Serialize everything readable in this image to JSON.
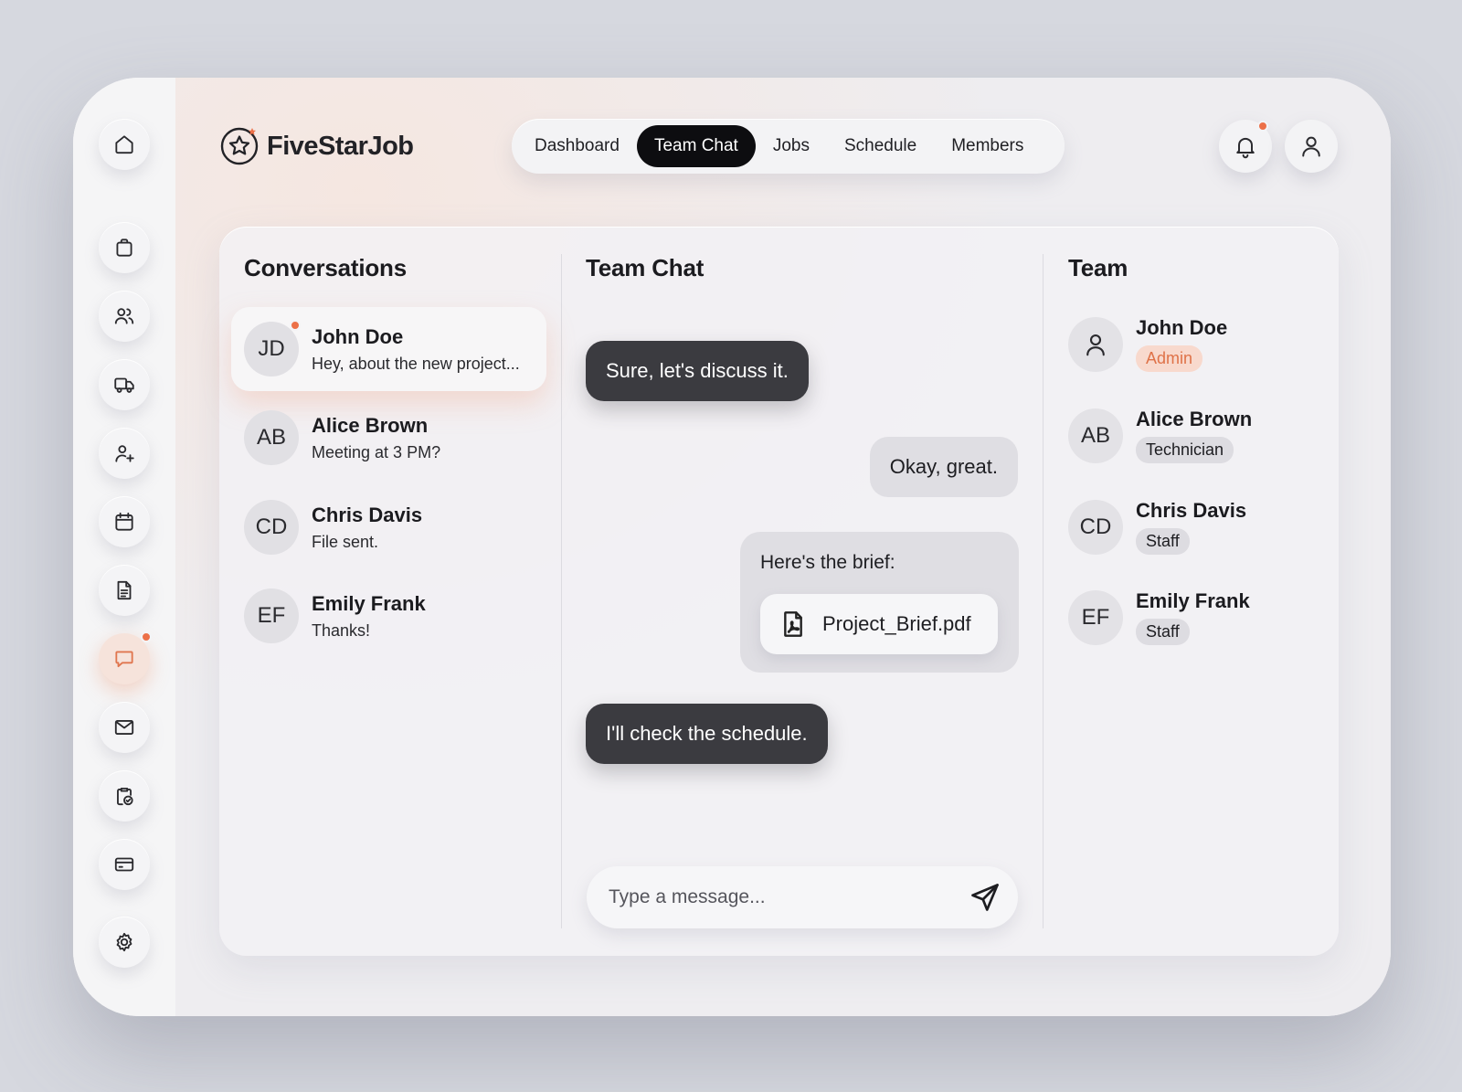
{
  "app": {
    "name": "FiveStarJob"
  },
  "nav": {
    "tabs": [
      {
        "label": "Dashboard"
      },
      {
        "label": "Team Chat",
        "active": true
      },
      {
        "label": "Jobs"
      },
      {
        "label": "Schedule"
      },
      {
        "label": "Members"
      }
    ]
  },
  "sidebar": {
    "items": [
      {
        "icon": "home-icon"
      },
      {
        "icon": "briefcase-icon"
      },
      {
        "icon": "users-icon"
      },
      {
        "icon": "truck-icon"
      },
      {
        "icon": "user-plus-icon"
      },
      {
        "icon": "calendar-icon"
      },
      {
        "icon": "document-icon"
      },
      {
        "icon": "chat-icon",
        "active": true,
        "notification": true
      },
      {
        "icon": "mail-icon"
      },
      {
        "icon": "clipboard-check-icon"
      },
      {
        "icon": "card-icon"
      },
      {
        "icon": "gear-icon"
      }
    ]
  },
  "conversations": {
    "title": "Conversations",
    "items": [
      {
        "initials": "JD",
        "name": "John Doe",
        "preview": "Hey, about the new project...",
        "active": true,
        "unread": true
      },
      {
        "initials": "AB",
        "name": "Alice Brown",
        "preview": "Meeting at 3 PM?"
      },
      {
        "initials": "CD",
        "name": "Chris Davis",
        "preview": "File sent."
      },
      {
        "initials": "EF",
        "name": "Emily Frank",
        "preview": "Thanks!"
      }
    ]
  },
  "chat": {
    "title": "Team Chat",
    "messages": [
      {
        "text": "Sure, let's discuss it.",
        "direction": "incoming"
      },
      {
        "text": "Okay, great.",
        "direction": "outgoing"
      },
      {
        "text": "Here's the brief:",
        "direction": "outgoing",
        "attachment": "Project_Brief.pdf"
      },
      {
        "text": "I'll check the schedule.",
        "direction": "incoming"
      }
    ],
    "input_placeholder": "Type a message..."
  },
  "team": {
    "title": "Team",
    "members": [
      {
        "initials": "",
        "name": "John Doe",
        "role": "Admin"
      },
      {
        "initials": "AB",
        "name": "Alice Brown",
        "role": "Technician"
      },
      {
        "initials": "CD",
        "name": "Chris Davis",
        "role": "Staff"
      },
      {
        "initials": "EF",
        "name": "Emily Frank",
        "role": "Staff"
      }
    ]
  },
  "colors": {
    "accent": "#ec7048",
    "dark_bubble": "#3b3b40",
    "active_tab": "#0d0d10"
  }
}
